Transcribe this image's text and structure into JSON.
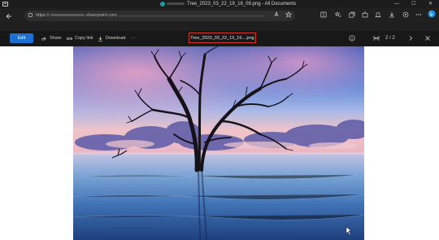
{
  "window": {
    "title": "Tree_2023_03_22_19_16_09.png - All Documents",
    "minimize_glyph": "—",
    "maximize_glyph": "☐",
    "close_glyph": "✕"
  },
  "browser": {
    "url_prefix": "https://",
    "url_suffix": ".sharepoint.com",
    "icons": [
      "read-aloud-icon",
      "favorite-icon",
      "split-screen-icon",
      "favorites-list-icon",
      "collections-icon",
      "extensions-icon",
      "notifications-icon",
      "downloads-icon",
      "copilot-icon",
      "more-icon",
      "bing-icon"
    ]
  },
  "toolbar": {
    "edit_label": "Edit",
    "share_label": "Share",
    "copy_link_label": "Copy link",
    "download_label": "Download",
    "more_label": "···",
    "file_name": "Tree_2023_03_22_19_16....png",
    "pager": "2 / 2"
  },
  "colors": {
    "accent": "#1b70d2",
    "highlight_border": "#d23a30",
    "chrome_dark": "#1f1f1f"
  }
}
